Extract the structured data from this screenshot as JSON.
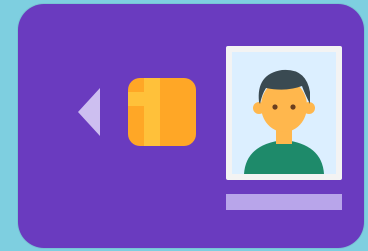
{
  "icon": {
    "name": "id-card-icon",
    "parts": [
      "back-arrow-icon",
      "chip-icon",
      "person-photo-icon",
      "name-bar"
    ]
  },
  "colors": {
    "background": "#7ecfe0",
    "card": "#6a3bbf",
    "arrow": "#cdbff0",
    "chip": "#ffa726",
    "chip_highlight": "#ffc13a",
    "photo_frame": "#f3f3f3",
    "photo_background": "#dcefff",
    "hair": "#3a4a52",
    "skin": "#ffb74d",
    "shirt": "#1e8a6a",
    "name_bar": "#b8a5ea"
  }
}
